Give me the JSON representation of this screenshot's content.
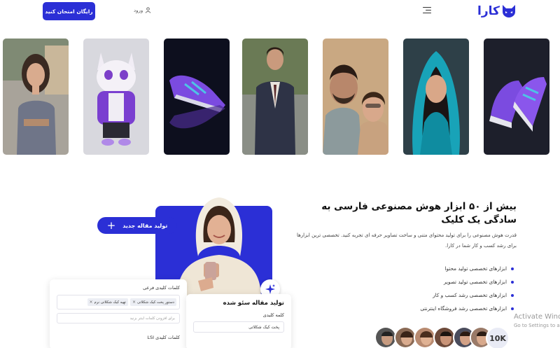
{
  "header": {
    "cta_label": "رایگان امتحان کنید",
    "login_label": "ورود",
    "logo_text": "کارا"
  },
  "gallery": {
    "items": [
      {
        "name": "woman-sweater-photo"
      },
      {
        "name": "purple-cat-mascot"
      },
      {
        "name": "purple-sneaker-dark"
      },
      {
        "name": "man-suit-photo"
      },
      {
        "name": "couple-photo"
      },
      {
        "name": "woman-hijab-photo"
      },
      {
        "name": "purple-sneaker-pair"
      }
    ]
  },
  "hero": {
    "title": "بیش از ۵۰ ابزار هوش مصنوعی فارسی به سادگی یک کلیک",
    "description": "قدرت هوش مصنوعی را برای تولید محتوای متنی و ساخت تصاویر حرفه ای تجربه کنید. تخصصی ترین ابزارها برای رشد کسب و کار شما در کارا.",
    "features": [
      "ابزارهای تخصصی تولید محتوا",
      "ابزارهای تخصصی تولید تصویر",
      "ابزارهای تخصصی رشد کسب و کار",
      "ابزارهای تخصصی رشد فروشگاه اینترنتی"
    ],
    "new_article_label": "تولید مقاله جدید"
  },
  "seo_card": {
    "title": "تولید مقاله سئو شده",
    "keyword_label": "کلمه کلیدی",
    "keyword_value": "پخت کیک شکلاتی"
  },
  "keyword_card": {
    "label": "کلمات کلیدی فرعی",
    "chips": [
      "دستور پخت کیک شکلاتی",
      "تهیه کیک شکلاتی نرم"
    ],
    "input_placeholder": "برای افزودن کلمات اینتر بزنید",
    "lsi_label": "کلمات کلیدی LSI"
  },
  "social_proof": {
    "count_label": "10K"
  },
  "os_overlay": {
    "line1": "Activate Windo",
    "line2": "Go to Settings to a"
  },
  "colors": {
    "accent": "#2b2fd6"
  }
}
